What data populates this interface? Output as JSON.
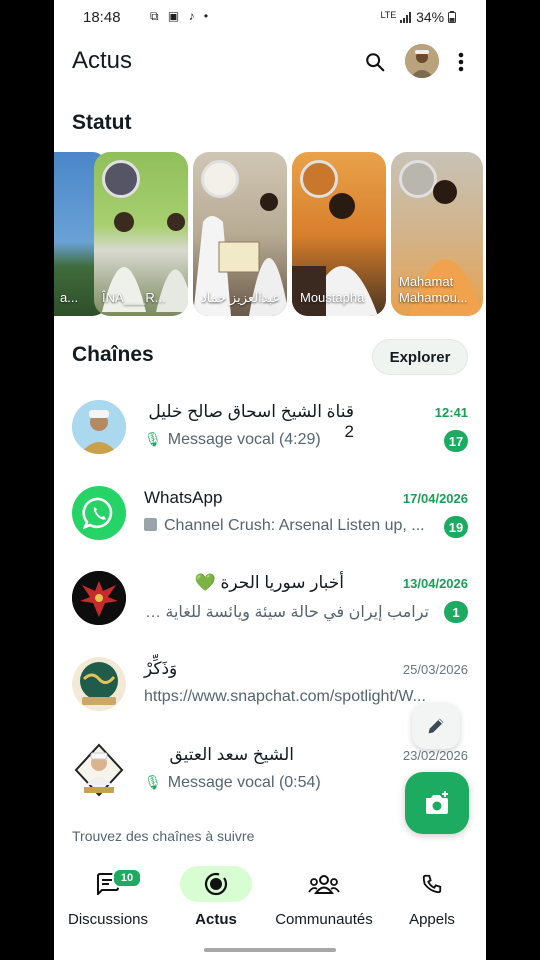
{
  "status_bar": {
    "time": "18:48",
    "notif_icons": "⧉ ▣ ♪ •",
    "network": "LTE",
    "battery": "34%"
  },
  "header": {
    "title": "Actus"
  },
  "statut": {
    "title": "Statut",
    "cards": [
      {
        "name": "a..."
      },
      {
        "name": "ÎNA___R..."
      },
      {
        "name": "عبدالعزيز حماد"
      },
      {
        "name": "Moustapha"
      },
      {
        "name": "Mahamat Mahamou..."
      }
    ]
  },
  "chaines": {
    "title": "Chaînes",
    "explore_label": "Explorer",
    "items": [
      {
        "title": "قناة الشيخ اسحاق صالح خليل 2",
        "date": "12:41",
        "subtitle": "Message vocal (4:29)",
        "unread": "17"
      },
      {
        "title": "WhatsApp",
        "date": "17/04/2026",
        "subtitle": "Channel Crush: Arsenal Listen up, ...",
        "unread": "19"
      },
      {
        "title": "أخبار سوريا الحرة 💚",
        "date": "13/04/2026",
        "subtitle": "ترامب إيران في حالة سيئة ويائسة للغاية ولن ...",
        "unread": "1"
      },
      {
        "title": "وَذَكِّرْ",
        "date": "25/03/2026",
        "subtitle": "https://www.snapchat.com/spotlight/W..."
      },
      {
        "title": "الشيخ سعد العتيق",
        "date": "23/02/2026",
        "subtitle": "Message vocal (0:54)"
      }
    ],
    "find_more": "Trouvez des chaînes à suivre"
  },
  "bottom_nav": {
    "items": [
      {
        "label": "Discussions",
        "badge": "10"
      },
      {
        "label": "Actus"
      },
      {
        "label": "Communautés"
      },
      {
        "label": "Appels"
      }
    ]
  },
  "colors": {
    "accent": "#1daa61",
    "active_pill": "#d8fdd2"
  }
}
